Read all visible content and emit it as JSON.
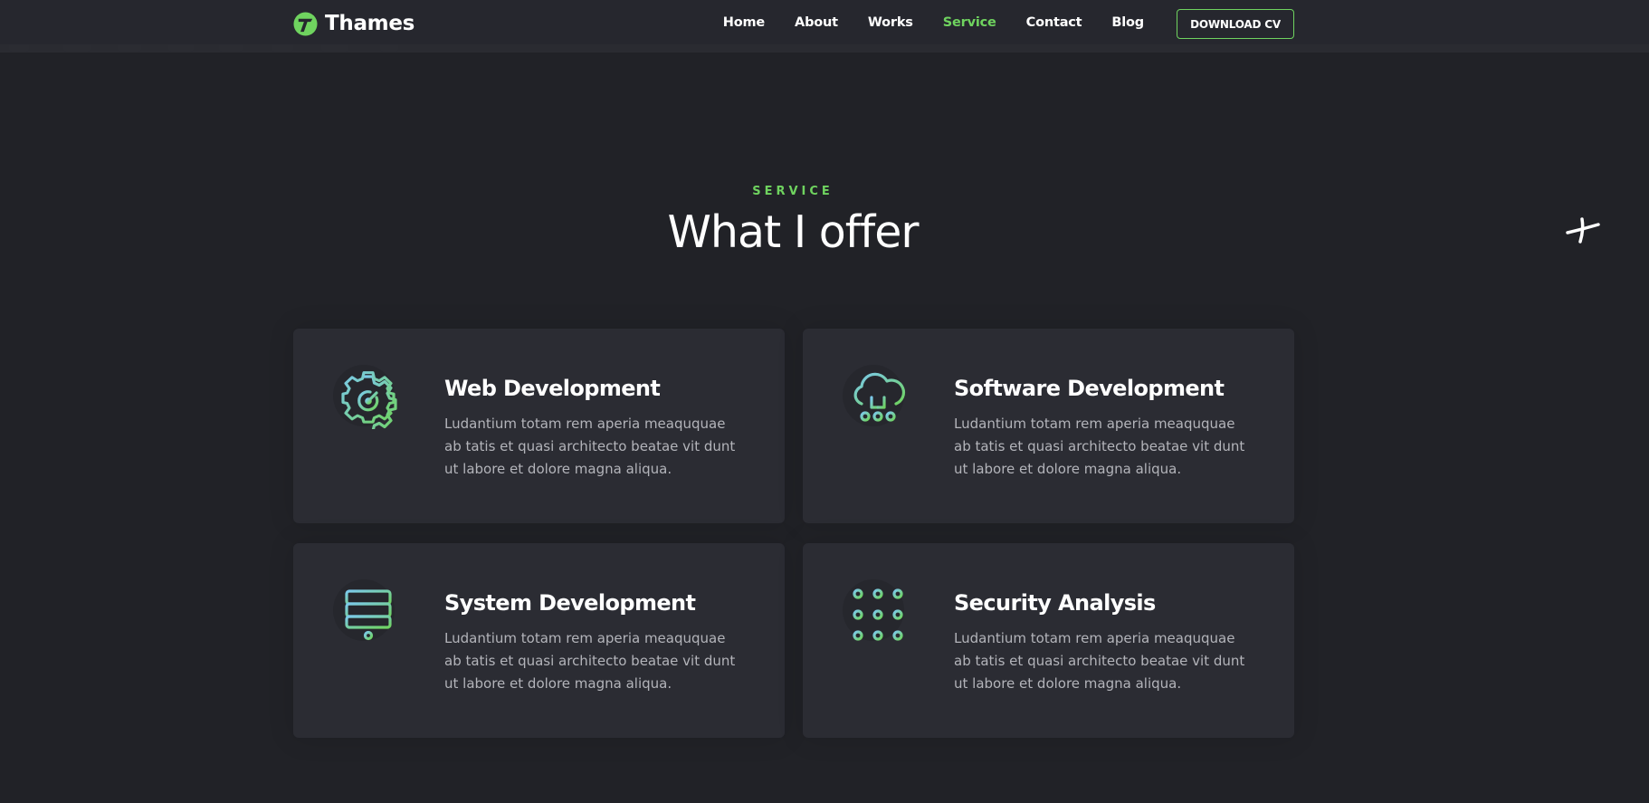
{
  "brand": {
    "name": "Thames",
    "accent_color": "#6fd35f"
  },
  "nav": {
    "items": [
      {
        "label": "Home"
      },
      {
        "label": "About"
      },
      {
        "label": "Works"
      },
      {
        "label": "Service",
        "active": true
      },
      {
        "label": "Contact"
      },
      {
        "label": "Blog"
      }
    ],
    "cta_label": "DOWNLOAD CV"
  },
  "section": {
    "subtitle": "SERVICE",
    "title": "What I offer"
  },
  "services": [
    {
      "icon": "gear-icon",
      "title": "Web Development",
      "description": "Ludantium totam rem aperia meaququae ab tatis et quasi architecto beatae vit dunt ut labore et dolore magna aliqua."
    },
    {
      "icon": "cloud-network-icon",
      "title": "Software Development",
      "description": "Ludantium totam rem aperia meaququae ab tatis et quasi architecto beatae vit dunt ut labore et dolore magna aliqua."
    },
    {
      "icon": "server-icon",
      "title": "System Development",
      "description": "Ludantium totam rem aperia meaququae ab tatis et quasi architecto beatae vit dunt ut labore et dolore magna aliqua."
    },
    {
      "icon": "circuit-icon",
      "title": "Security Analysis",
      "description": "Ludantium totam rem aperia meaququae ab tatis et quasi architecto beatae vit dunt ut labore et dolore magna aliqua."
    }
  ],
  "colors": {
    "background": "#212227",
    "header": "#26272e",
    "card": "#2b2c33",
    "icon_gradient_start": "#7cc9ec",
    "icon_gradient_end": "#6fd35f"
  }
}
